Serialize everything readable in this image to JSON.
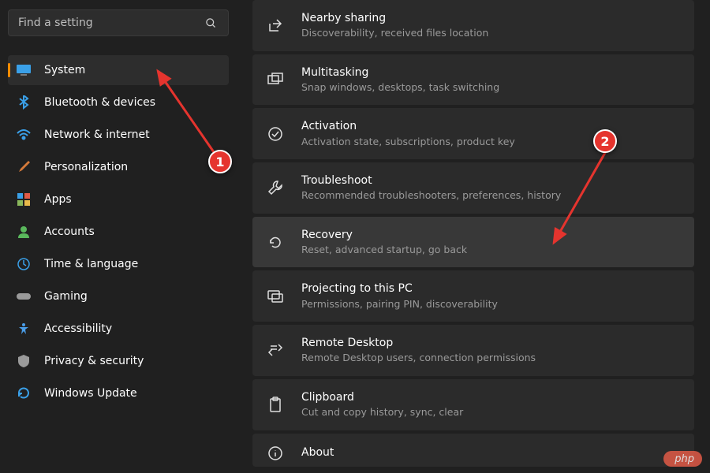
{
  "search": {
    "placeholder": "Find a setting"
  },
  "sidebar": {
    "items": [
      {
        "label": "System"
      },
      {
        "label": "Bluetooth & devices"
      },
      {
        "label": "Network & internet"
      },
      {
        "label": "Personalization"
      },
      {
        "label": "Apps"
      },
      {
        "label": "Accounts"
      },
      {
        "label": "Time & language"
      },
      {
        "label": "Gaming"
      },
      {
        "label": "Accessibility"
      },
      {
        "label": "Privacy & security"
      },
      {
        "label": "Windows Update"
      }
    ]
  },
  "settings": {
    "items": [
      {
        "title": "Nearby sharing",
        "desc": "Discoverability, received files location"
      },
      {
        "title": "Multitasking",
        "desc": "Snap windows, desktops, task switching"
      },
      {
        "title": "Activation",
        "desc": "Activation state, subscriptions, product key"
      },
      {
        "title": "Troubleshoot",
        "desc": "Recommended troubleshooters, preferences, history"
      },
      {
        "title": "Recovery",
        "desc": "Reset, advanced startup, go back"
      },
      {
        "title": "Projecting to this PC",
        "desc": "Permissions, pairing PIN, discoverability"
      },
      {
        "title": "Remote Desktop",
        "desc": "Remote Desktop users, connection permissions"
      },
      {
        "title": "Clipboard",
        "desc": "Cut and copy history, sync, clear"
      },
      {
        "title": "About",
        "desc": ""
      }
    ]
  },
  "annotations": {
    "badge1": "1",
    "badge2": "2",
    "watermark": "php"
  },
  "colors": {
    "accent": "#ff8c00",
    "annotation": "#e5342e"
  }
}
